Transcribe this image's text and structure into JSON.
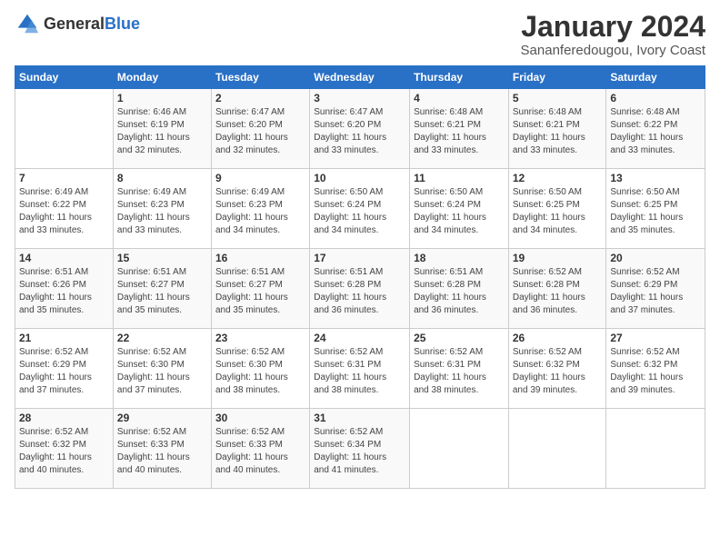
{
  "logo": {
    "text_general": "General",
    "text_blue": "Blue"
  },
  "title": "January 2024",
  "subtitle": "Sananferedougou, Ivory Coast",
  "headers": [
    "Sunday",
    "Monday",
    "Tuesday",
    "Wednesday",
    "Thursday",
    "Friday",
    "Saturday"
  ],
  "weeks": [
    [
      {
        "day": "",
        "info": ""
      },
      {
        "day": "1",
        "info": "Sunrise: 6:46 AM\nSunset: 6:19 PM\nDaylight: 11 hours\nand 32 minutes."
      },
      {
        "day": "2",
        "info": "Sunrise: 6:47 AM\nSunset: 6:20 PM\nDaylight: 11 hours\nand 32 minutes."
      },
      {
        "day": "3",
        "info": "Sunrise: 6:47 AM\nSunset: 6:20 PM\nDaylight: 11 hours\nand 33 minutes."
      },
      {
        "day": "4",
        "info": "Sunrise: 6:48 AM\nSunset: 6:21 PM\nDaylight: 11 hours\nand 33 minutes."
      },
      {
        "day": "5",
        "info": "Sunrise: 6:48 AM\nSunset: 6:21 PM\nDaylight: 11 hours\nand 33 minutes."
      },
      {
        "day": "6",
        "info": "Sunrise: 6:48 AM\nSunset: 6:22 PM\nDaylight: 11 hours\nand 33 minutes."
      }
    ],
    [
      {
        "day": "7",
        "info": "Sunrise: 6:49 AM\nSunset: 6:22 PM\nDaylight: 11 hours\nand 33 minutes."
      },
      {
        "day": "8",
        "info": "Sunrise: 6:49 AM\nSunset: 6:23 PM\nDaylight: 11 hours\nand 33 minutes."
      },
      {
        "day": "9",
        "info": "Sunrise: 6:49 AM\nSunset: 6:23 PM\nDaylight: 11 hours\nand 34 minutes."
      },
      {
        "day": "10",
        "info": "Sunrise: 6:50 AM\nSunset: 6:24 PM\nDaylight: 11 hours\nand 34 minutes."
      },
      {
        "day": "11",
        "info": "Sunrise: 6:50 AM\nSunset: 6:24 PM\nDaylight: 11 hours\nand 34 minutes."
      },
      {
        "day": "12",
        "info": "Sunrise: 6:50 AM\nSunset: 6:25 PM\nDaylight: 11 hours\nand 34 minutes."
      },
      {
        "day": "13",
        "info": "Sunrise: 6:50 AM\nSunset: 6:25 PM\nDaylight: 11 hours\nand 35 minutes."
      }
    ],
    [
      {
        "day": "14",
        "info": "Sunrise: 6:51 AM\nSunset: 6:26 PM\nDaylight: 11 hours\nand 35 minutes."
      },
      {
        "day": "15",
        "info": "Sunrise: 6:51 AM\nSunset: 6:27 PM\nDaylight: 11 hours\nand 35 minutes."
      },
      {
        "day": "16",
        "info": "Sunrise: 6:51 AM\nSunset: 6:27 PM\nDaylight: 11 hours\nand 35 minutes."
      },
      {
        "day": "17",
        "info": "Sunrise: 6:51 AM\nSunset: 6:28 PM\nDaylight: 11 hours\nand 36 minutes."
      },
      {
        "day": "18",
        "info": "Sunrise: 6:51 AM\nSunset: 6:28 PM\nDaylight: 11 hours\nand 36 minutes."
      },
      {
        "day": "19",
        "info": "Sunrise: 6:52 AM\nSunset: 6:28 PM\nDaylight: 11 hours\nand 36 minutes."
      },
      {
        "day": "20",
        "info": "Sunrise: 6:52 AM\nSunset: 6:29 PM\nDaylight: 11 hours\nand 37 minutes."
      }
    ],
    [
      {
        "day": "21",
        "info": "Sunrise: 6:52 AM\nSunset: 6:29 PM\nDaylight: 11 hours\nand 37 minutes."
      },
      {
        "day": "22",
        "info": "Sunrise: 6:52 AM\nSunset: 6:30 PM\nDaylight: 11 hours\nand 37 minutes."
      },
      {
        "day": "23",
        "info": "Sunrise: 6:52 AM\nSunset: 6:30 PM\nDaylight: 11 hours\nand 38 minutes."
      },
      {
        "day": "24",
        "info": "Sunrise: 6:52 AM\nSunset: 6:31 PM\nDaylight: 11 hours\nand 38 minutes."
      },
      {
        "day": "25",
        "info": "Sunrise: 6:52 AM\nSunset: 6:31 PM\nDaylight: 11 hours\nand 38 minutes."
      },
      {
        "day": "26",
        "info": "Sunrise: 6:52 AM\nSunset: 6:32 PM\nDaylight: 11 hours\nand 39 minutes."
      },
      {
        "day": "27",
        "info": "Sunrise: 6:52 AM\nSunset: 6:32 PM\nDaylight: 11 hours\nand 39 minutes."
      }
    ],
    [
      {
        "day": "28",
        "info": "Sunrise: 6:52 AM\nSunset: 6:32 PM\nDaylight: 11 hours\nand 40 minutes."
      },
      {
        "day": "29",
        "info": "Sunrise: 6:52 AM\nSunset: 6:33 PM\nDaylight: 11 hours\nand 40 minutes."
      },
      {
        "day": "30",
        "info": "Sunrise: 6:52 AM\nSunset: 6:33 PM\nDaylight: 11 hours\nand 40 minutes."
      },
      {
        "day": "31",
        "info": "Sunrise: 6:52 AM\nSunset: 6:34 PM\nDaylight: 11 hours\nand 41 minutes."
      },
      {
        "day": "",
        "info": ""
      },
      {
        "day": "",
        "info": ""
      },
      {
        "day": "",
        "info": ""
      }
    ]
  ]
}
